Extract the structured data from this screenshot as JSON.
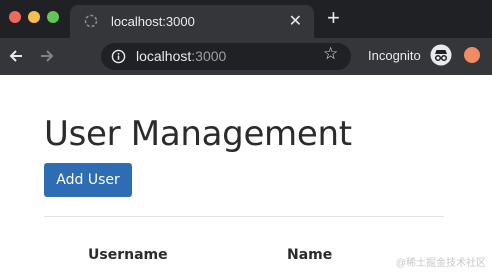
{
  "browser": {
    "tab_title": "localhost:3000",
    "url_host": "localhost",
    "url_port": ":3000",
    "incognito_label": "Incognito",
    "colors": {
      "frame": "#202124",
      "toolbar": "#35363a",
      "close": "#ed6a5e",
      "minimize": "#f5bf4f",
      "maximize": "#62c555"
    }
  },
  "icons": {
    "back": "arrow-left-icon",
    "forward": "arrow-right-icon",
    "info": "info-icon",
    "star": "star-icon",
    "incognito": "incognito-icon",
    "extension": "extension-icon"
  },
  "page": {
    "title": "User Management",
    "add_button_label": "Add User",
    "accent": "#2e6db4",
    "table": {
      "headers": [
        "Username",
        "Name"
      ]
    }
  },
  "watermark": "@稀土掘金技术社区"
}
